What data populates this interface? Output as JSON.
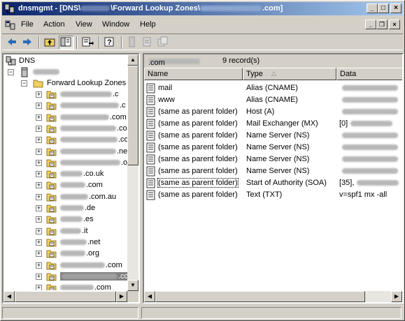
{
  "window": {
    "title": "dnsmgmt - [DNS\\",
    "title_mid": "\\Forward Lookup Zones\\",
    "title_end": ".com]"
  },
  "menu": {
    "file": "File",
    "action": "Action",
    "view": "View",
    "window": "Window",
    "help": "Help"
  },
  "tree": {
    "root": "DNS",
    "forward_lookup_zones": "Forward Lookup Zones",
    "zone_suffixes": [
      ".c",
      ".c",
      ".com",
      ".com",
      ".com",
      ".ne",
      ".org",
      ".co.uk",
      ".com",
      ".com.au",
      ".de",
      ".es",
      ".it",
      ".net",
      ".org",
      ".com",
      ".com",
      ".com"
    ]
  },
  "list": {
    "zone_suffix": ".com",
    "record_count": "9 record(s)",
    "columns": {
      "name": "Name",
      "type": "Type",
      "data": "Data"
    },
    "rows": [
      {
        "name": "mail",
        "type": "Alias (CNAME)",
        "data": ""
      },
      {
        "name": "www",
        "type": "Alias (CNAME)",
        "data": ""
      },
      {
        "name": "(same as parent folder)",
        "type": "Host (A)",
        "data": ""
      },
      {
        "name": "(same as parent folder)",
        "type": "Mail Exchanger (MX)",
        "data": "[0]"
      },
      {
        "name": "(same as parent folder)",
        "type": "Name Server (NS)",
        "data": ""
      },
      {
        "name": "(same as parent folder)",
        "type": "Name Server (NS)",
        "data": ""
      },
      {
        "name": "(same as parent folder)",
        "type": "Name Server (NS)",
        "data": ""
      },
      {
        "name": "(same as parent folder)",
        "type": "Name Server (NS)",
        "data": ""
      },
      {
        "name": "(same as parent folder)",
        "type": "Start of Authority (SOA)",
        "data": "[35],"
      },
      {
        "name": "(same as parent folder)",
        "type": "Text (TXT)",
        "data": "v=spf1 mx -all"
      }
    ]
  },
  "colors": {
    "title_start": "#0a246a",
    "title_end": "#a6caf0",
    "chrome": "#d4d0c8",
    "selection": "#808080"
  }
}
